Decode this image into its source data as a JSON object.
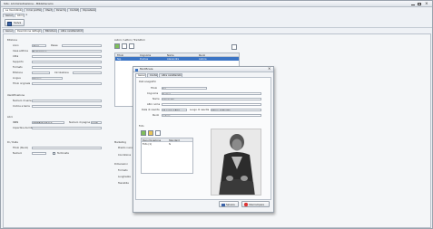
{
  "app": {
    "title": "Sito: Amministrazione - Bibliotecario"
  },
  "menu": {
    "items": [
      "La mia biblioteca",
      "Il mio profilo",
      "Utenti",
      "Ricerche",
      "Contatti",
      "Impostazioni"
    ]
  },
  "outer_tabs": [
    "Generale",
    "Libri (2)"
  ],
  "toolbar": {
    "save_label": "Salva"
  },
  "sub_tabs": [
    "Generale",
    "Descrizione dettagliata",
    "Biblioteca",
    "Altre caratteristiche"
  ],
  "left_form": {
    "section_title": "Edizione",
    "anno_label": "Anno",
    "anno_value": "2012",
    "paese_label": "Paese",
    "casa_label": "Casa editrice",
    "casa_value": "Flammarion",
    "citta_label": "Città",
    "supporto_label": "Supporto",
    "formato_label": "Formato",
    "edizione_label": "Edizione",
    "circolazione_label": "Circolazione",
    "lingua_label": "Lingua",
    "lingua_value": "Italiano",
    "titolo_orig_label": "Titolo originale",
    "ident_title": "Identificazione",
    "numero_label": "Numero di serie",
    "codice_label": "Codice a barre",
    "libro_title": "Libro",
    "isbn_label": "ISBN",
    "isbn_value": "9788806196110",
    "pagine_label": "Numero di pagine",
    "pagine_value": "1248",
    "copertina_label": "Copertina del libro",
    "serie_title": "Di / Dalla",
    "titolo_label": "Titolo (Ruolo)",
    "numero2_label": "Numero",
    "terminato_label": "Terminata"
  },
  "authors": {
    "title": "Autori / Lettori / Traduttori",
    "headers": [
      "Titolo",
      "Cognome",
      "Nome",
      "Ruolo"
    ],
    "rows": [
      [
        "Sig.",
        "Dumas",
        "Alexandre",
        "Autore"
      ]
    ]
  },
  "right_labels": [
    "Marketing",
    "Prezzo nuovo",
    "Condizione",
    "Dimensioni",
    "Formato",
    "Lunghezza",
    "Tascabile"
  ],
  "dialog": {
    "title": "Modificare",
    "tabs": [
      "Generale",
      "Contatto",
      "Altre caratteristiche"
    ],
    "section_title": "Dati anagrafici",
    "titolo_label": "Titolo",
    "titolo_value": "Sig.",
    "cognome_label": "Cognome",
    "cognome_value": "Dumas",
    "nome_label": "Nome",
    "nome_value": "Alexandre",
    "altro_label": "Altro nome",
    "data_label": "Data di nascita",
    "data_value": "24 luglio 1802",
    "luogo_label": "Luogo di nascita",
    "luogo_value": "Villers-Cotterêts",
    "ruolo_label": "Ruolo",
    "ruolo_value": "Autore",
    "foto_title": "Foto",
    "foto_headers": [
      "Denominazione",
      "Standard"
    ],
    "foto_row": [
      "Foto (1)",
      "Sì"
    ],
    "save_label": "Salvare",
    "cancel_label": "Interrompere"
  },
  "colors": {
    "accent": "#3b74c4",
    "window_bg": "#eef1f5",
    "border": "#9aa3ad"
  }
}
